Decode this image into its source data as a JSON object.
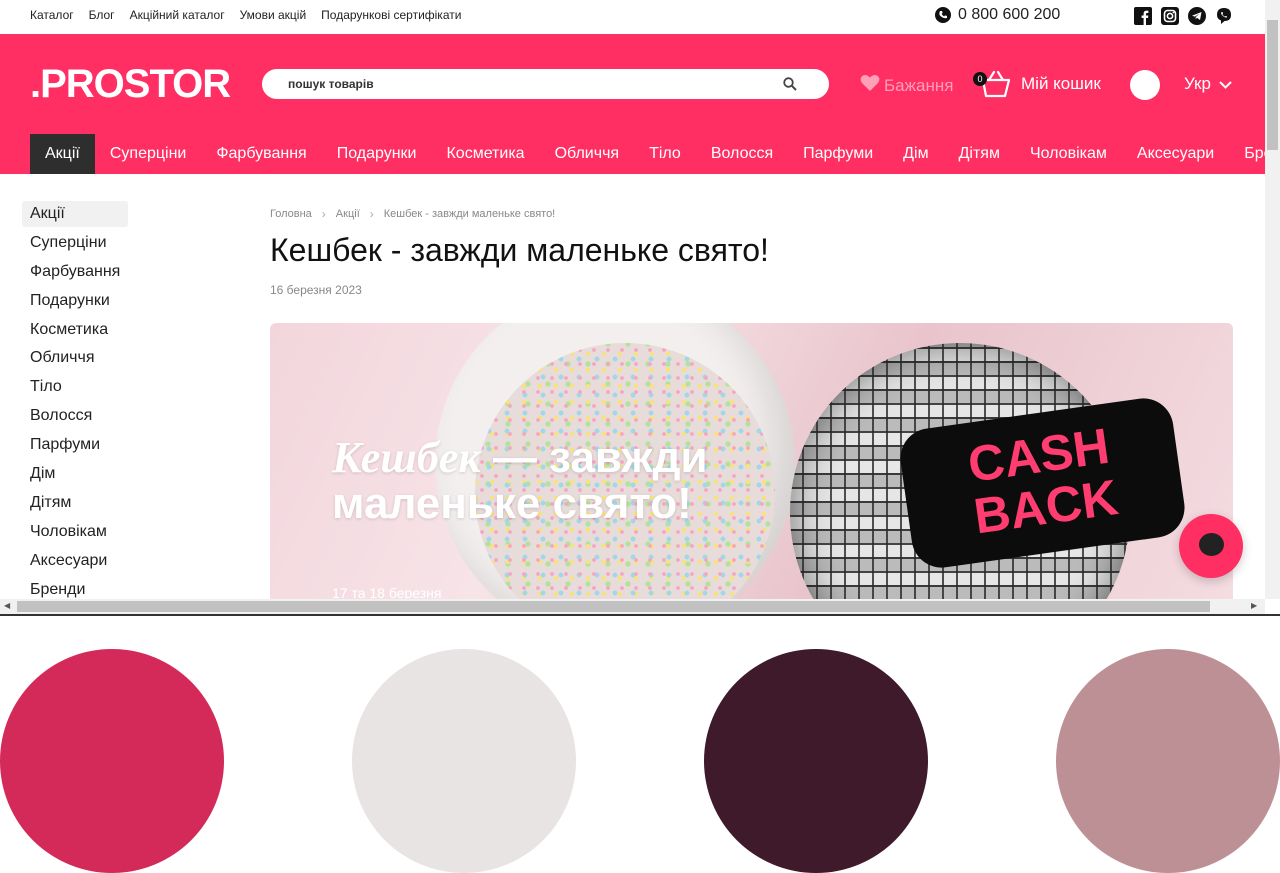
{
  "topbar": {
    "links": [
      "Каталог",
      "Блог",
      "Акційний каталог",
      "Умови акцій",
      "Подарункові сертифікати"
    ],
    "phone": "0 800 600 200",
    "socials": [
      "facebook-icon",
      "instagram-icon",
      "telegram-icon",
      "viber-icon"
    ]
  },
  "header": {
    "logo": ".PROSTOR",
    "search_placeholder": "пошук товарів",
    "wishlist": "Бажання",
    "cart_label": "Мій кошик",
    "cart_count": "0",
    "language": "Укр"
  },
  "categories": [
    "Акції",
    "Суперціни",
    "Фарбування",
    "Подарунки",
    "Косметика",
    "Обличчя",
    "Тіло",
    "Волосся",
    "Парфуми",
    "Дім",
    "Дітям",
    "Чоловікам",
    "Аксесуари",
    "Бренди"
  ],
  "sidebar": [
    "Акції",
    "Суперціни",
    "Фарбування",
    "Подарунки",
    "Косметика",
    "Обличчя",
    "Тіло",
    "Волосся",
    "Парфуми",
    "Дім",
    "Дітям",
    "Чоловікам",
    "Аксесуари",
    "Бренди"
  ],
  "breadcrumbs": [
    "Головна",
    "Акції",
    "Кешбек - завжди маленьке свято!"
  ],
  "article": {
    "title": "Кешбек - завжди маленьке свято!",
    "date": "16 березня 2023"
  },
  "banner": {
    "line1_italic": "Кешбек",
    "line1_rest": " — завжди",
    "line2": "маленьке свято!",
    "cash_line1": "CASH",
    "cash_line2": "BACK",
    "date": "17 та 18 березня"
  },
  "colors": {
    "brand": "#ff2e63",
    "palette": [
      "#d42a5a",
      "#e8e4e3",
      "#3e1a2b",
      "#bd9096"
    ]
  }
}
